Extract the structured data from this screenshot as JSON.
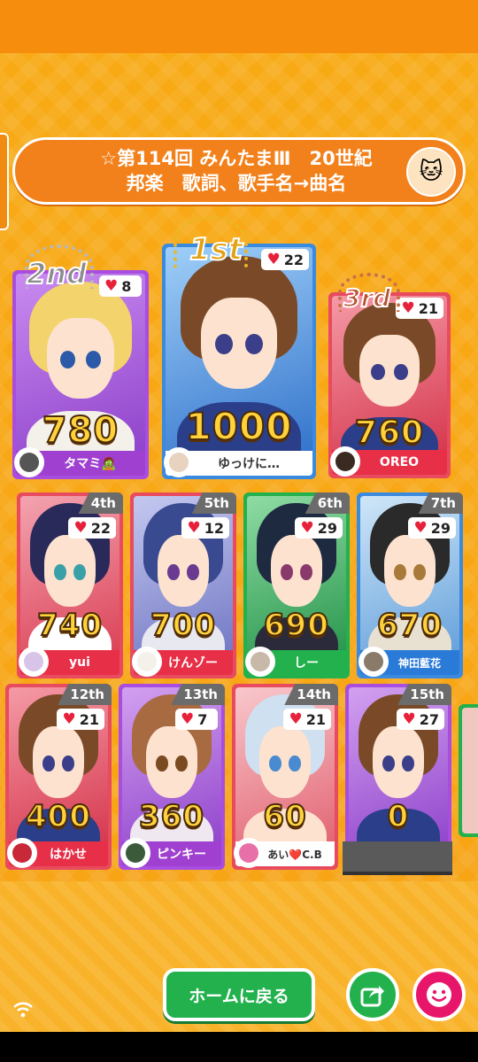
{
  "banner": {
    "title_line1": "☆第114回 みんたまⅢ　20世紀",
    "title_line2": "邦楽　歌詞、歌手名→曲名",
    "host_icon": "cat-mascot-icon"
  },
  "podium": [
    {
      "rank_label": "2nd",
      "likes": "8",
      "score": "780",
      "name": "タマミ🧟",
      "name_color": "#a040d0"
    },
    {
      "rank_label": "1st",
      "likes": "22",
      "score": "1000",
      "name": "ゆっけに…",
      "name_color": "#2a7ad8"
    },
    {
      "rank_label": "3rd",
      "likes": "21",
      "score": "760",
      "name": "OREO",
      "name_color": "#e82f48"
    }
  ],
  "row2": [
    {
      "rank_label": "4th",
      "likes": "22",
      "score": "740",
      "name": "yui",
      "name_color": "#e82f48"
    },
    {
      "rank_label": "5th",
      "likes": "12",
      "score": "700",
      "name": "けんゾー",
      "name_color": "#e82f48"
    },
    {
      "rank_label": "6th",
      "likes": "29",
      "score": "690",
      "name": "しー",
      "name_color": "#22b14c"
    },
    {
      "rank_label": "7th",
      "likes": "29",
      "score": "670",
      "name": "神田藍花",
      "name_color": "#2a7ad8"
    }
  ],
  "row3": [
    {
      "rank_label": "12th",
      "likes": "21",
      "score": "400",
      "name": "はかせ",
      "name_color": "#e82f48"
    },
    {
      "rank_label": "13th",
      "likes": "7",
      "score": "360",
      "name": "ピンキー",
      "name_color": "#a040d0"
    },
    {
      "rank_label": "14th",
      "likes": "21",
      "score": "60",
      "name": "あい❤️C.B",
      "name_color": "#e82f48"
    },
    {
      "rank_label": "15th",
      "likes": "27",
      "score": "0",
      "name": "",
      "name_color": "#a040d0"
    }
  ],
  "buttons": {
    "home": "ホームに戻る",
    "share_icon": "share-icon",
    "stamp_icon": "smiley-icon"
  },
  "status": {
    "connection_icon": "wifi-icon"
  }
}
